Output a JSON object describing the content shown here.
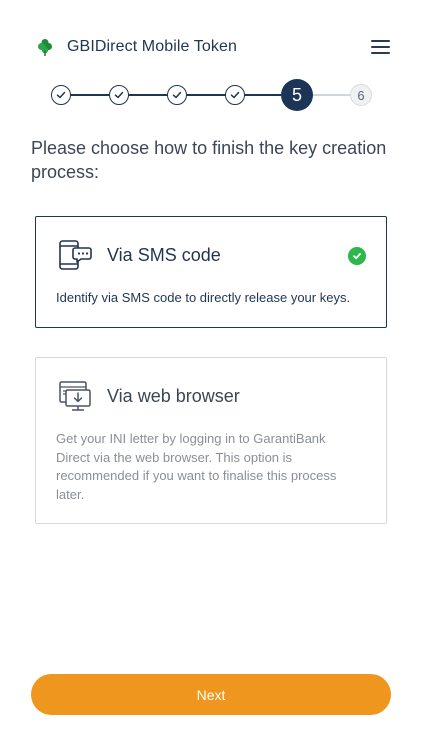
{
  "app": {
    "title": "GBIDirect  Mobile Token"
  },
  "stepper": {
    "current_step": 5,
    "total_steps": 6,
    "active_label": "5",
    "future_label": "6"
  },
  "main": {
    "prompt": "Please choose how to finish the key creation process:",
    "options": [
      {
        "title": "Via SMS code",
        "description": "Identify via SMS code to directly release your keys.",
        "selected": true
      },
      {
        "title": "Via web browser",
        "description": "Get your INI letter by logging in to GarantiBank Direct via the web browser. This option is recommended if you want to finalise this process later.",
        "selected": false
      }
    ]
  },
  "footer": {
    "next_label": "Next"
  },
  "colors": {
    "primary": "#1f3552",
    "accent": "#ee961d",
    "success": "#2db84b",
    "muted": "#8a8f96"
  },
  "icons": [
    "clover-logo-icon",
    "menu-icon",
    "check-icon",
    "sms-phone-icon",
    "web-browser-icon",
    "check-circle-icon"
  ]
}
